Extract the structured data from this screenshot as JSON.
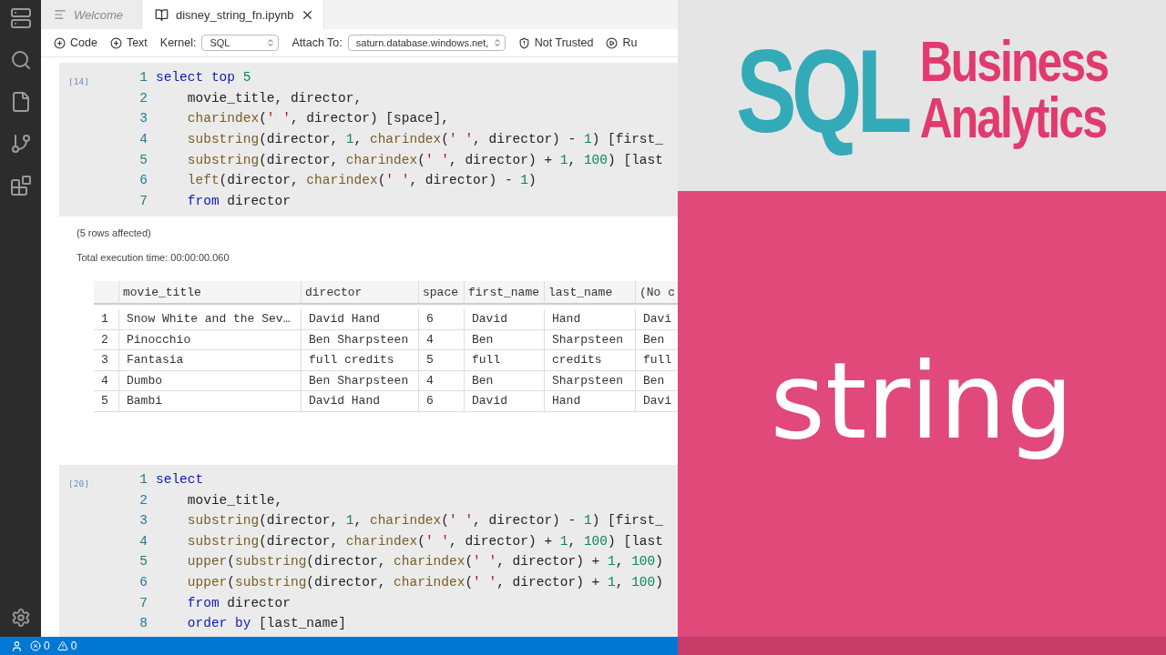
{
  "tabs": [
    {
      "kind": "welcome",
      "label": "Welcome",
      "selected": false
    },
    {
      "kind": "notebook",
      "label": "disney_string_fn.ipynb",
      "selected": true
    }
  ],
  "toolbar": {
    "add_code": "Code",
    "add_text": "Text",
    "kernel_label": "Kernel:",
    "kernel": "SQL",
    "attach_label": "Attach To:",
    "attach": "saturn.database.windows.net,",
    "trust": "Not Trusted",
    "run": "Ru"
  },
  "cells": [
    {
      "count": "[14]",
      "lines": [
        {
          "number": "1",
          "indented": false,
          "tokens": [
            {
              "kind": "keyword",
              "text": "select"
            },
            {
              "kind": "keyword",
              "text": " top"
            },
            {
              "kind": "number",
              "text": " 5"
            }
          ]
        },
        {
          "number": "2",
          "indented": true,
          "tokens": [
            {
              "kind": "plain",
              "text": "movie_title, director,"
            }
          ]
        },
        {
          "number": "3",
          "indented": true,
          "tokens": [
            {
              "kind": "function",
              "text": "charindex"
            },
            {
              "kind": "plain",
              "text": "("
            },
            {
              "kind": "string",
              "text": "' '"
            },
            {
              "kind": "plain",
              "text": ", director) [space],"
            }
          ]
        },
        {
          "number": "4",
          "indented": true,
          "tokens": [
            {
              "kind": "function",
              "text": "substring"
            },
            {
              "kind": "plain",
              "text": "(director, "
            },
            {
              "kind": "number",
              "text": "1"
            },
            {
              "kind": "plain",
              "text": ", "
            },
            {
              "kind": "function",
              "text": "charindex"
            },
            {
              "kind": "plain",
              "text": "("
            },
            {
              "kind": "string",
              "text": "' '"
            },
            {
              "kind": "plain",
              "text": ", director) - "
            },
            {
              "kind": "number",
              "text": "1"
            },
            {
              "kind": "plain",
              "text": ") [first_"
            }
          ]
        },
        {
          "number": "5",
          "indented": true,
          "tokens": [
            {
              "kind": "function",
              "text": "substring"
            },
            {
              "kind": "plain",
              "text": "(director, "
            },
            {
              "kind": "function",
              "text": "charindex"
            },
            {
              "kind": "plain",
              "text": "("
            },
            {
              "kind": "string",
              "text": "' '"
            },
            {
              "kind": "plain",
              "text": ", director) + "
            },
            {
              "kind": "number",
              "text": "1"
            },
            {
              "kind": "plain",
              "text": ", "
            },
            {
              "kind": "number",
              "text": "100"
            },
            {
              "kind": "plain",
              "text": ") [last"
            }
          ]
        },
        {
          "number": "6",
          "indented": true,
          "tokens": [
            {
              "kind": "function",
              "text": "left"
            },
            {
              "kind": "plain",
              "text": "(director, "
            },
            {
              "kind": "function",
              "text": "charindex"
            },
            {
              "kind": "plain",
              "text": "("
            },
            {
              "kind": "string",
              "text": "' '"
            },
            {
              "kind": "plain",
              "text": ", director) - "
            },
            {
              "kind": "number",
              "text": "1"
            },
            {
              "kind": "plain",
              "text": ")"
            }
          ]
        },
        {
          "number": "7",
          "indented": true,
          "tokens": [
            {
              "kind": "keyword",
              "text": "from"
            },
            {
              "kind": "plain",
              "text": " director"
            }
          ]
        }
      ],
      "output": {
        "messages": [
          "(5 rows affected)",
          "Total execution time: 00:00:00.060"
        ],
        "columns": [
          "movie_title",
          "director",
          "space",
          "first_name",
          "last_name",
          "(No c"
        ],
        "rows": [
          {
            "number": "1",
            "cells": [
              "Snow White and the Sev…",
              "David Hand",
              "6",
              "David",
              "Hand",
              "Davi"
            ]
          },
          {
            "number": "2",
            "cells": [
              "Pinocchio",
              "Ben Sharpsteen",
              "4",
              "Ben",
              "Sharpsteen",
              "Ben"
            ]
          },
          {
            "number": "3",
            "cells": [
              "Fantasia",
              "full credits",
              "5",
              "full",
              "credits",
              "full"
            ]
          },
          {
            "number": "4",
            "cells": [
              "Dumbo",
              "Ben Sharpsteen",
              "4",
              "Ben",
              "Sharpsteen",
              "Ben"
            ]
          },
          {
            "number": "5",
            "cells": [
              "Bambi",
              "David Hand",
              "6",
              "David",
              "Hand",
              "Davi"
            ]
          }
        ]
      }
    },
    {
      "count": "[20]",
      "lines": [
        {
          "number": "1",
          "indented": false,
          "tokens": [
            {
              "kind": "keyword",
              "text": "select"
            }
          ]
        },
        {
          "number": "2",
          "indented": true,
          "tokens": [
            {
              "kind": "plain",
              "text": "movie_title,"
            }
          ]
        },
        {
          "number": "3",
          "indented": true,
          "tokens": [
            {
              "kind": "function",
              "text": "substring"
            },
            {
              "kind": "plain",
              "text": "(director, "
            },
            {
              "kind": "number",
              "text": "1"
            },
            {
              "kind": "plain",
              "text": ", "
            },
            {
              "kind": "function",
              "text": "charindex"
            },
            {
              "kind": "plain",
              "text": "("
            },
            {
              "kind": "string",
              "text": "' '"
            },
            {
              "kind": "plain",
              "text": ", director) - "
            },
            {
              "kind": "number",
              "text": "1"
            },
            {
              "kind": "plain",
              "text": ") [first_"
            }
          ]
        },
        {
          "number": "4",
          "indented": true,
          "tokens": [
            {
              "kind": "function",
              "text": "substring"
            },
            {
              "kind": "plain",
              "text": "(director, "
            },
            {
              "kind": "function",
              "text": "charindex"
            },
            {
              "kind": "plain",
              "text": "("
            },
            {
              "kind": "string",
              "text": "' '"
            },
            {
              "kind": "plain",
              "text": ", director) + "
            },
            {
              "kind": "number",
              "text": "1"
            },
            {
              "kind": "plain",
              "text": ", "
            },
            {
              "kind": "number",
              "text": "100"
            },
            {
              "kind": "plain",
              "text": ") [last"
            }
          ]
        },
        {
          "number": "5",
          "indented": true,
          "tokens": [
            {
              "kind": "function",
              "text": "upper"
            },
            {
              "kind": "plain",
              "text": "("
            },
            {
              "kind": "function",
              "text": "substring"
            },
            {
              "kind": "plain",
              "text": "(director, "
            },
            {
              "kind": "function",
              "text": "charindex"
            },
            {
              "kind": "plain",
              "text": "("
            },
            {
              "kind": "string",
              "text": "' '"
            },
            {
              "kind": "plain",
              "text": ", director) + "
            },
            {
              "kind": "number",
              "text": "1"
            },
            {
              "kind": "plain",
              "text": ", "
            },
            {
              "kind": "number",
              "text": "100"
            },
            {
              "kind": "plain",
              "text": ")"
            }
          ]
        },
        {
          "number": "6",
          "indented": true,
          "tokens": [
            {
              "kind": "function",
              "text": "upper"
            },
            {
              "kind": "plain",
              "text": "("
            },
            {
              "kind": "function",
              "text": "substring"
            },
            {
              "kind": "plain",
              "text": "(director, "
            },
            {
              "kind": "function",
              "text": "charindex"
            },
            {
              "kind": "plain",
              "text": "("
            },
            {
              "kind": "string",
              "text": "' '"
            },
            {
              "kind": "plain",
              "text": ", director) + "
            },
            {
              "kind": "number",
              "text": "1"
            },
            {
              "kind": "plain",
              "text": ", "
            },
            {
              "kind": "number",
              "text": "100"
            },
            {
              "kind": "plain",
              "text": ")"
            }
          ]
        },
        {
          "number": "7",
          "indented": true,
          "tokens": [
            {
              "kind": "keyword",
              "text": "from"
            },
            {
              "kind": "plain",
              "text": " director"
            }
          ]
        },
        {
          "number": "8",
          "indented": true,
          "tokens": [
            {
              "kind": "keyword",
              "text": "order by"
            },
            {
              "kind": "plain",
              "text": " [last_name]"
            }
          ]
        }
      ]
    }
  ],
  "status_bar": {
    "errors": "0",
    "warnings": "0"
  },
  "banner": {
    "logo_mark": "SQL",
    "logo_lines": [
      "Business",
      "Analytics"
    ],
    "topic": "string"
  }
}
